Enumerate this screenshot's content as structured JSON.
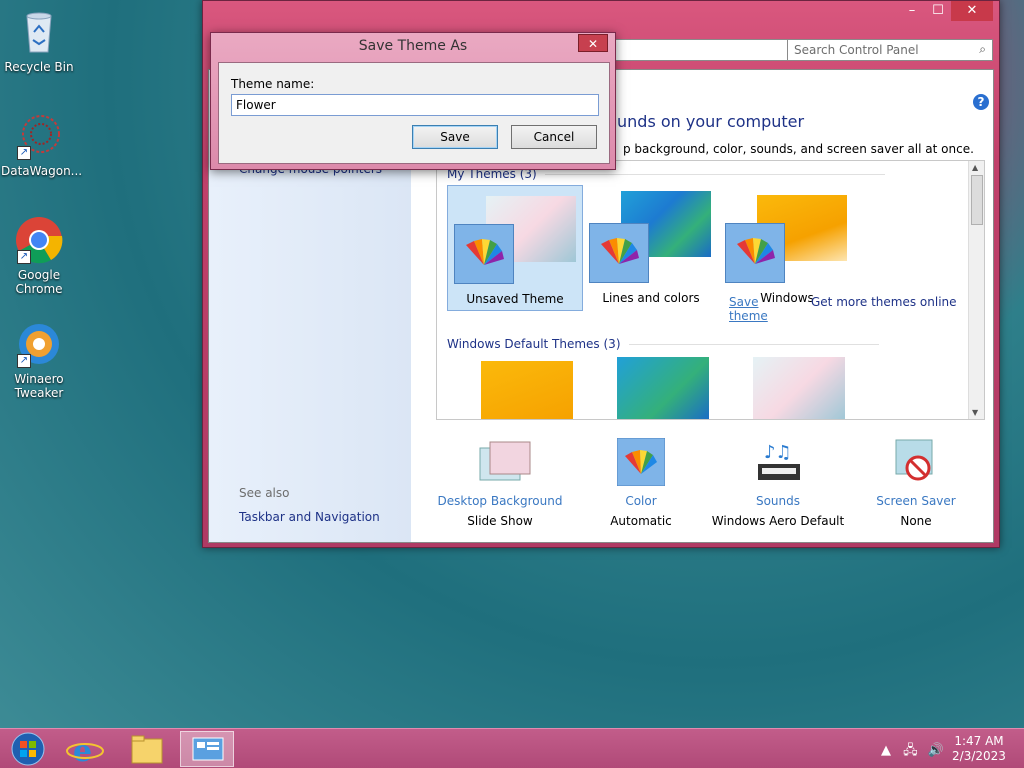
{
  "desktop": {
    "icons": [
      {
        "label": "Recycle Bin"
      },
      {
        "label": "DataWagon..."
      },
      {
        "label": "Google Chrome"
      },
      {
        "label": "Winaero Tweaker"
      }
    ]
  },
  "control_panel": {
    "search_placeholder": "Search Control Panel",
    "heading_partial": "unds on your computer",
    "subheading_partial": "p background, color, sounds, and screen saver all at once.",
    "left_partial_link": "Change mouse pointers",
    "see_also": "See also",
    "taskbar_navigation": "Taskbar and Navigation",
    "my_themes_header": "My Themes (3)",
    "default_themes_header": "Windows Default Themes (3)",
    "my_themes": [
      {
        "label": "Unsaved Theme"
      },
      {
        "label": "Lines and colors"
      },
      {
        "label": "Windows"
      }
    ],
    "save_theme_link": "Save theme",
    "more_themes_link": "Get more themes online",
    "bottom_items": [
      {
        "link": "Desktop Background",
        "value": "Slide Show"
      },
      {
        "link": "Color",
        "value": "Automatic"
      },
      {
        "link": "Sounds",
        "value": "Windows Aero Default"
      },
      {
        "link": "Screen Saver",
        "value": "None"
      }
    ]
  },
  "dialog": {
    "title": "Save Theme As",
    "label": "Theme name:",
    "value": "Flower",
    "save": "Save",
    "cancel": "Cancel"
  },
  "taskbar": {
    "time": "1:47 AM",
    "date": "2/3/2023"
  }
}
